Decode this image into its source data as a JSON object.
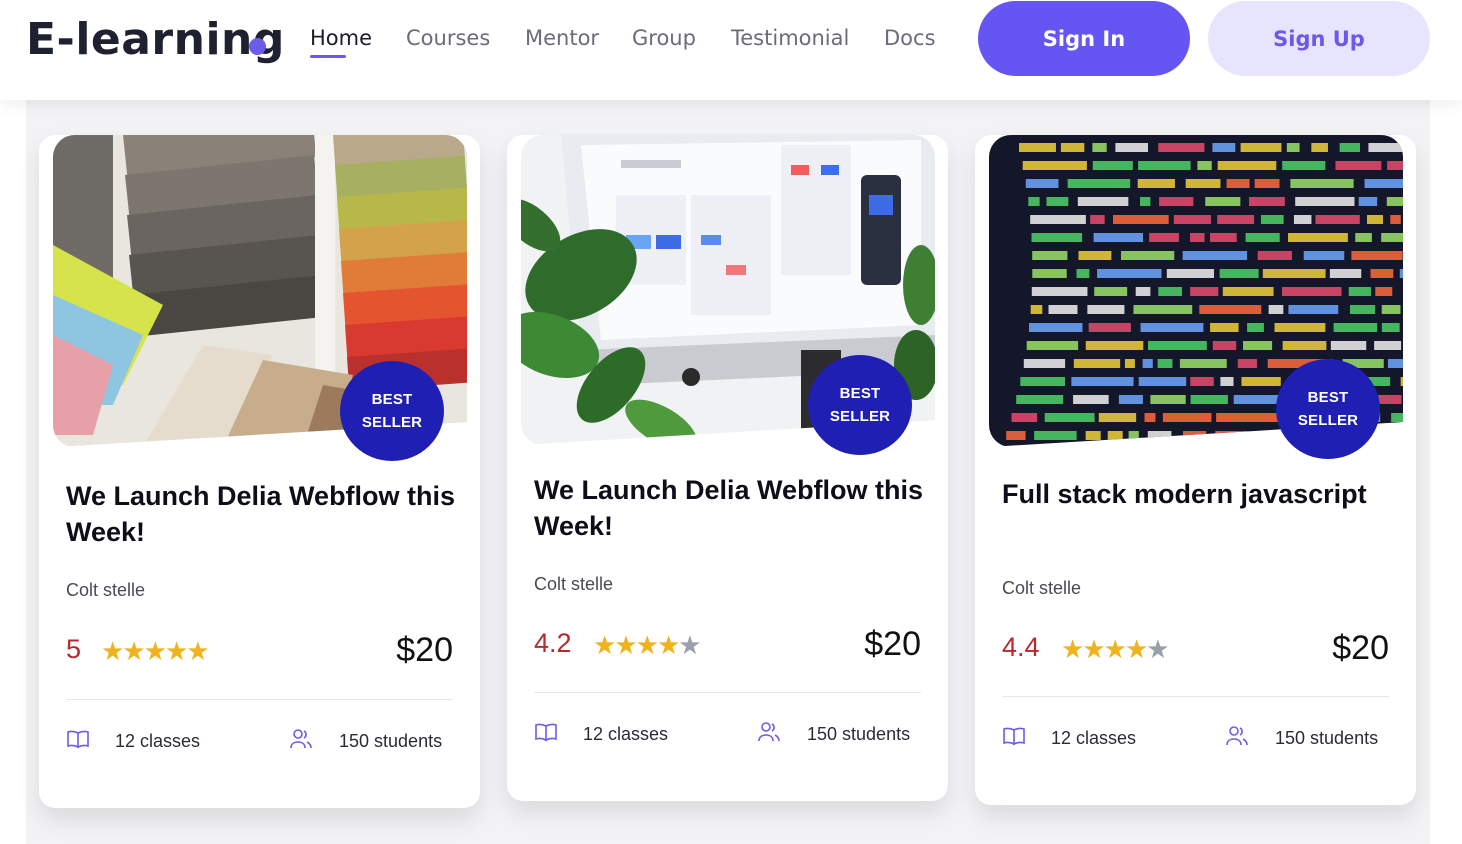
{
  "brand": {
    "logo_text": "E-learning",
    "accent": "#6c5ce7"
  },
  "nav": {
    "items": [
      {
        "label": "Home",
        "active": true
      },
      {
        "label": "Courses"
      },
      {
        "label": "Mentor"
      },
      {
        "label": "Group"
      },
      {
        "label": "Testimonial"
      },
      {
        "label": "Docs"
      }
    ],
    "sign_in": "Sign In",
    "sign_up": "Sign Up"
  },
  "cards": [
    {
      "image_icon": "fabric-swatches-image",
      "badge_line1": "BEST",
      "badge_line2": "SELLER",
      "title": "We Launch Delia Webflow this Week!",
      "author": "Colt stelle",
      "rating": "5",
      "rating_value": 5,
      "price": "$20",
      "classes": "12 classes",
      "students": "150 students"
    },
    {
      "image_icon": "monitor-with-plants-image",
      "badge_line1": "BEST",
      "badge_line2": "SELLER",
      "title": "We Launch Delia Webflow this Week!",
      "author": "Colt stelle",
      "rating": "4.2",
      "rating_value": 4.2,
      "price": "$20",
      "classes": "12 classes",
      "students": "150 students"
    },
    {
      "image_icon": "source-code-screen-image",
      "badge_line1": "BEST",
      "badge_line2": "SELLER",
      "title": "Full stack modern javascript",
      "author": "Colt stelle",
      "rating": "4.4",
      "rating_value": 4.4,
      "price": "$20",
      "classes": "12 classes",
      "students": "150 students"
    }
  ],
  "colors": {
    "primary_button": "#6556f3",
    "secondary_button": "#e7e4fd",
    "badge": "#1f1fb3",
    "rating_text": "#b8292e",
    "star_filled": "#efb31d",
    "star_empty": "#9aa0aa"
  }
}
